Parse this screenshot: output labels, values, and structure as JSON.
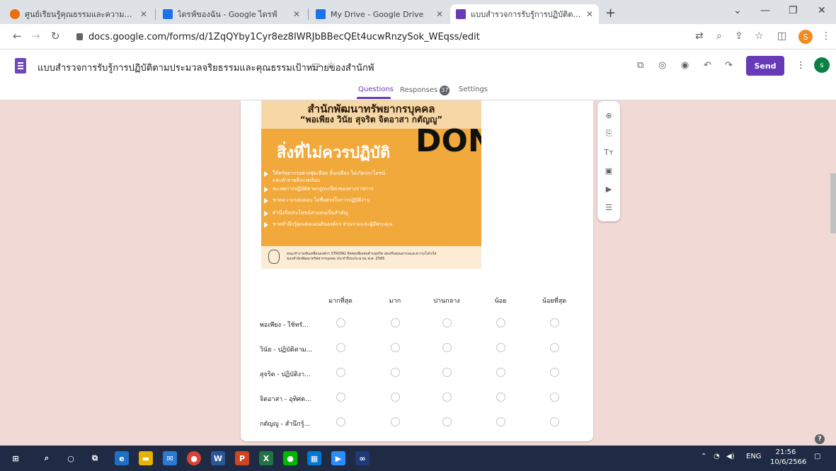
{
  "browser": {
    "tabs": [
      {
        "title": "ศูนย์เรียนรู้คุณธรรมและความโปร่งใสของ",
        "favicon_color": "#e8710a"
      },
      {
        "title": "ไดรฟ์ของฉัน - Google ไดรฟ์",
        "favicon_color": "#1a73e8"
      },
      {
        "title": "My Drive - Google Drive",
        "favicon_color": "#1a73e8"
      },
      {
        "title": "แบบสำรวจการรับรู้การปฏิบัติตามประมวล",
        "favicon_color": "#673ab7"
      }
    ],
    "new_tab_label": "+",
    "url": "docs.google.com/forms/d/1ZqQYby1Cyr8ez8IWRJbBBecQEt4ucwRnzySok_WEqss/edit",
    "profile_initial": "S"
  },
  "forms": {
    "doc_title": "แบบสำรวจการรับรู้การปฏิบัติตามประมวลจริยธรรมและคุณธรรมเป้าหมายของสำนักพั",
    "send_label": "Send",
    "avatar_initial": "s",
    "tabs": {
      "questions": "Questions",
      "responses": "Responses",
      "responses_count": "37",
      "settings": "Settings"
    },
    "accent_color": "#673ab7"
  },
  "poster": {
    "heading": "สำนักพัฒนาทรัพยากรบุคคล",
    "subheading": "“พอเพียง วินัย สุจริต จิตอาสา กตัญญู”",
    "title": "สิ่งที่ไม่ควรปฏิบัติ",
    "dont": "DONT",
    "bullets": [
      "ใช้ทรัพยากรอย่างฟุ่มเฟือย สิ้นเปลือง ไม่เกิดประโยชน์",
      "และทำลายสิ่งแวดล้อม",
      "ละเลยการปฏิบัติตามกฎระเบียบของทางราชการ",
      "ขาดความรอบคอบ ไม่ซื่อตรงในการปฏิบัติงาน",
      "คำนึงถึงประโยชน์ส่วนตนเป็นสำคัญ",
      "ขาดสำนึกรู้คุณต่อแผ่นดินองค์กร ส่วนรวมและผู้มีพระคุณ"
    ],
    "footer_line1": "คณะทำงานขับเคลื่อนองค์กร STRONG จิตพอเพียงต่อต้านทุจริต ส่งเสริมคุณธรรมและความโปร่งใส",
    "footer_line2": "ของสำนักพัฒนาทรัพยากรบุคคล ประจำปีงบประมาณ พ.ศ. 2566"
  },
  "grid": {
    "columns": [
      "มากที่สุด",
      "มาก",
      "ปานกลาง",
      "น้อย",
      "น้อยที่สุด"
    ],
    "rows": [
      "พอเพียง - ใช้ทรั...",
      "วินัย - ปฏิบัติตาม...",
      "สุจริต - ปฏิบัติงา...",
      "จิตอาสา - อุทิศต...",
      "กตัญญู - สำนึกรู้..."
    ]
  },
  "taskbar": {
    "lang": "ENG",
    "time": "21:56",
    "date": "10/6/2566"
  }
}
